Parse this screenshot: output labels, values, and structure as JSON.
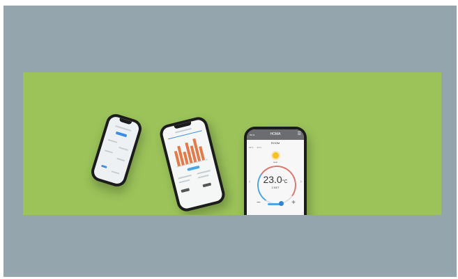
{
  "phone3": {
    "header_title": "HOMA",
    "status_time": "09:41",
    "room": "ROOM",
    "indoor": "23°C",
    "outdoor": "24°C",
    "mode": "Heat",
    "temperature": "23.0",
    "unit": "°C",
    "set_label": "3 SET",
    "minus": "−",
    "plus": "+",
    "prev": "‹",
    "next": "›"
  },
  "colors": {
    "outer_bg": "#95a5ad",
    "banner_bg": "#9bc35a",
    "accent_blue": "#4aa7e3",
    "accent_red": "#d9796d",
    "chart_orange": "#e27a4a"
  }
}
